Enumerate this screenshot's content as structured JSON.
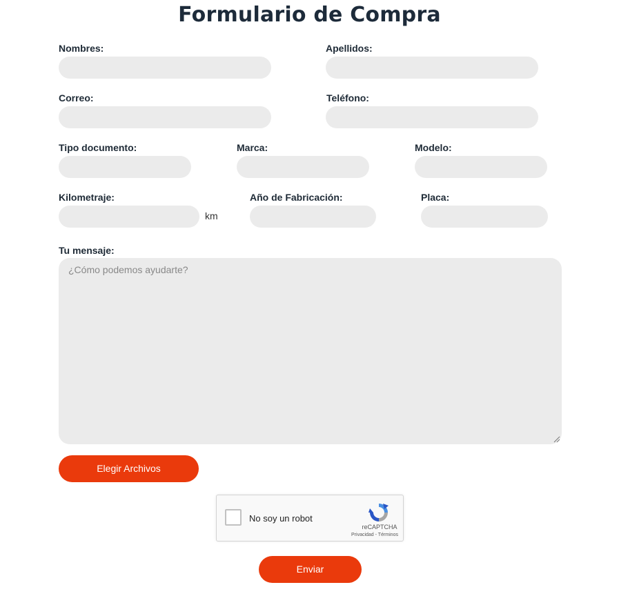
{
  "form": {
    "title": "Formulario de Compra",
    "labels": {
      "nombres": "Nombres:",
      "apellidos": "Apellidos:",
      "correo": "Correo:",
      "telefono": "Teléfono:",
      "tipo_documento": "Tipo documento:",
      "marca": "Marca:",
      "modelo": "Modelo:",
      "kilometraje": "Kilometraje:",
      "anio": "Año de Fabricación:",
      "placa": "Placa:",
      "mensaje": "Tu mensaje:"
    },
    "km_unit": "km",
    "mensaje_placeholder": "¿Cómo podemos ayudarte?",
    "file_button": "Elegir Archivos",
    "submit_button": "Enviar"
  },
  "captcha": {
    "label": "No soy un robot",
    "brand": "reCAPTCHA",
    "links": "Privacidad - Términos"
  },
  "colors": {
    "accent": "#ea3a0c",
    "field_bg": "#ebebeb",
    "title": "#1d2b3a"
  }
}
